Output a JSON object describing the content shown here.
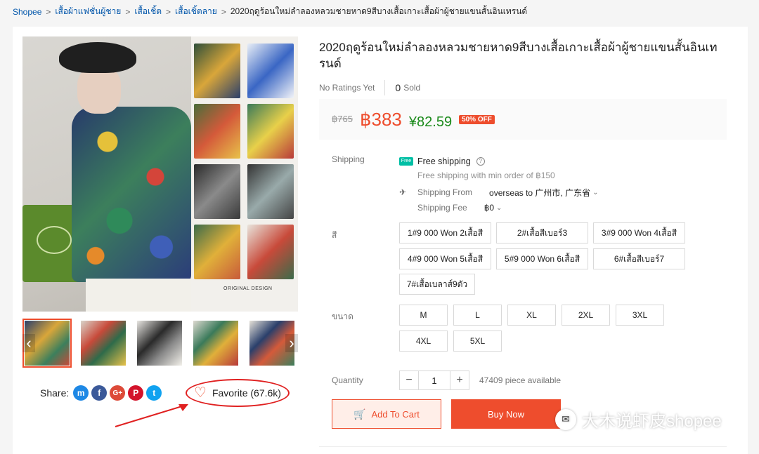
{
  "breadcrumb": {
    "items": [
      "Shopee",
      "เสื้อผ้าแฟชั่นผู้ชาย",
      "เสื้อเชิ้ต",
      "เสื้อเชิ้ตลาย",
      "2020ฤดูร้อนใหม่ลำลองหลวมชายหาด9สีบางเสื้อเกาะเสื้อผ้าผู้ชายแขนสั้นอินเทรนด์"
    ],
    "separator": ">"
  },
  "gallery": {
    "collage_caption": "ORIGINAL DESIGN",
    "prev_icon": "chevron-left-icon",
    "next_icon": "chevron-right-icon"
  },
  "share": {
    "label": "Share:",
    "networks": [
      {
        "name": "messenger-icon",
        "glyph": "m",
        "color": "#1e88e5"
      },
      {
        "name": "facebook-icon",
        "glyph": "f",
        "color": "#3b5999"
      },
      {
        "name": "google-plus-icon",
        "glyph": "G+",
        "color": "#dd4b39"
      },
      {
        "name": "pinterest-icon",
        "glyph": "P",
        "color": "#d3132b"
      },
      {
        "name": "twitter-icon",
        "glyph": "t",
        "color": "#10a2f0"
      }
    ]
  },
  "favorite": {
    "label": "Favorite (67.6k)",
    "heart": "♡"
  },
  "product": {
    "title": "2020ฤดูร้อนใหม่ลำลองหลวมชายหาด9สีบางเสื้อเกาะเสื้อผ้าผู้ชายแขนสั้นอินเทรนด์",
    "ratings": "No Ratings Yet",
    "sold_count": "0",
    "sold_label": "Sold"
  },
  "price": {
    "original": "฿765",
    "current": "฿383",
    "cny": "¥82.59",
    "discount": "50% OFF"
  },
  "shipping": {
    "label": "Shipping",
    "free_badge": "Free",
    "free_text": "Free shipping",
    "free_note": "Free shipping with min order of ฿150",
    "from_label": "Shipping From",
    "from_value": "overseas to 广州市, 广东省",
    "fee_label": "Shipping Fee",
    "fee_value": "฿0"
  },
  "color_option": {
    "label": "สี",
    "options": [
      "1#9 000 Won 2เสื้อสี",
      "2#เสื้อสีเบอร์3",
      "3#9 000 Won 4เสื้อสี",
      "4#9 000 Won 5เสื้อสี",
      "5#9 000 Won 6เสื้อสี",
      "6#เสื้อสีเบอร์7",
      "7#เสื้อเบลาส์9ตัว"
    ]
  },
  "size_option": {
    "label": "ขนาด",
    "options": [
      "M",
      "L",
      "XL",
      "2XL",
      "3XL",
      "4XL",
      "5XL"
    ]
  },
  "quantity": {
    "label": "Quantity",
    "value": "1",
    "minus": "−",
    "plus": "+",
    "available": "47409 piece available"
  },
  "actions": {
    "add_to_cart": "Add To Cart",
    "buy_now": "Buy Now"
  },
  "watermark": {
    "text": "大木说虾皮shopee"
  },
  "colors": {
    "accent": "#ee4d2d",
    "link": "#0055aa",
    "cny": "#1a8a1a",
    "free": "#00bfa5"
  }
}
